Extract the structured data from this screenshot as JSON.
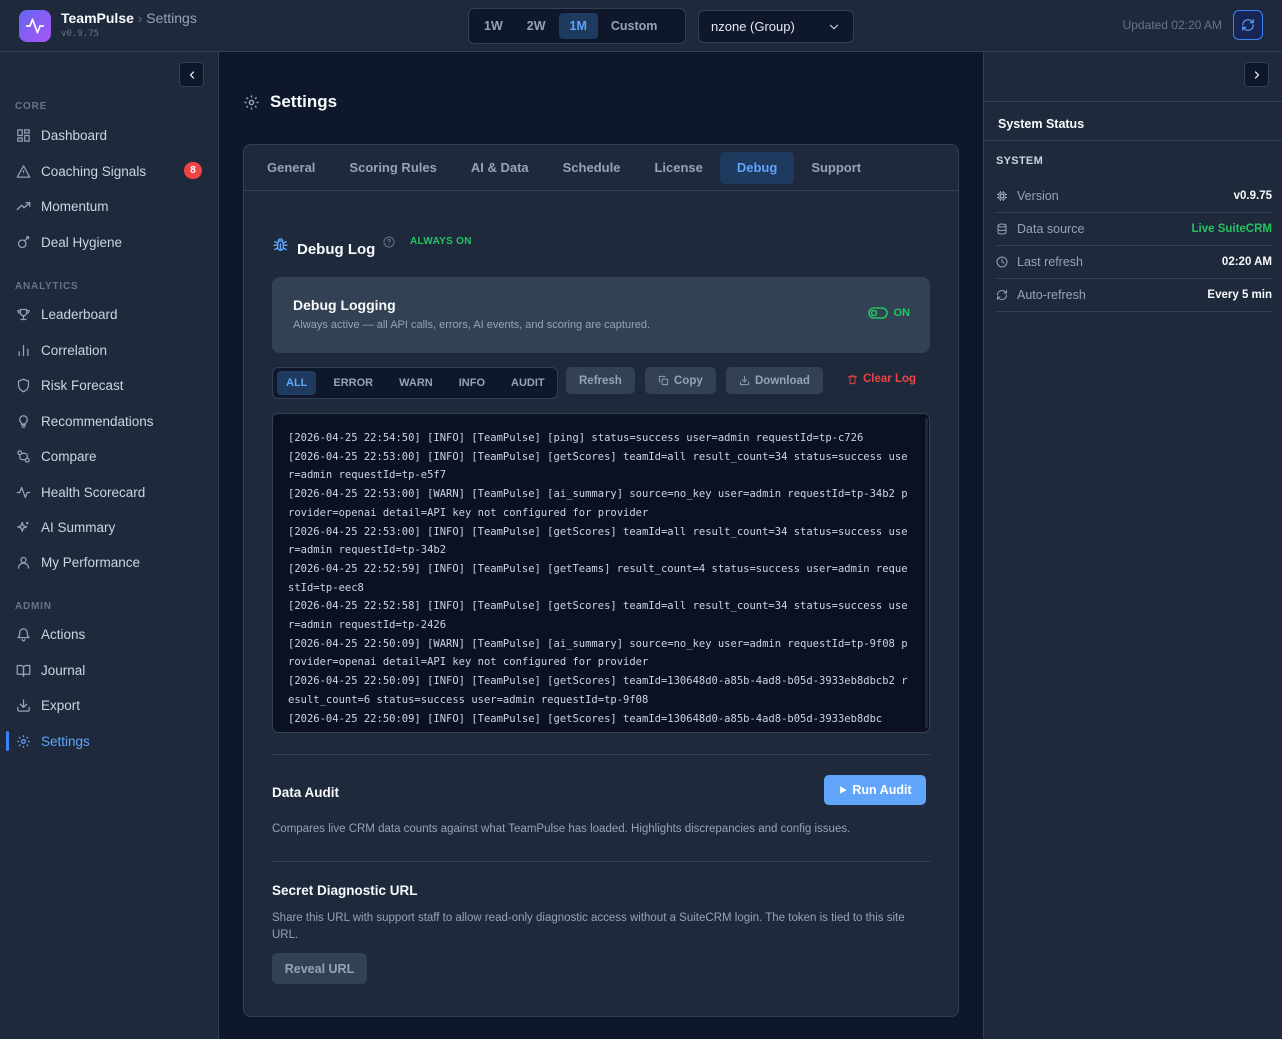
{
  "app": {
    "name": "TeamPulse",
    "page": "Settings",
    "version": "v0.9.75",
    "separator": "›"
  },
  "header": {
    "ranges": [
      "1W",
      "2W",
      "1M",
      "Custom"
    ],
    "active_range": "1M",
    "team_select": "nzone (Group)",
    "updated": "Updated 02:20 AM"
  },
  "sidebar": {
    "sections": [
      {
        "label": "CORE",
        "items": [
          {
            "label": "Dashboard",
            "icon": "dashboard-icon"
          },
          {
            "label": "Coaching Signals",
            "icon": "warning-icon",
            "badge": "8"
          },
          {
            "label": "Momentum",
            "icon": "trend-icon"
          },
          {
            "label": "Deal Hygiene",
            "icon": "hygiene-icon"
          }
        ]
      },
      {
        "label": "ANALYTICS",
        "items": [
          {
            "label": "Leaderboard",
            "icon": "trophy-icon"
          },
          {
            "label": "Correlation",
            "icon": "bar-chart-icon"
          },
          {
            "label": "Risk Forecast",
            "icon": "shield-icon"
          },
          {
            "label": "Recommendations",
            "icon": "lightbulb-icon"
          },
          {
            "label": "Compare",
            "icon": "compare-icon"
          },
          {
            "label": "Health Scorecard",
            "icon": "pulse-icon"
          },
          {
            "label": "AI Summary",
            "icon": "sparkles-icon"
          },
          {
            "label": "My Performance",
            "icon": "user-icon"
          }
        ]
      },
      {
        "label": "ADMIN",
        "items": [
          {
            "label": "Actions",
            "icon": "bell-icon"
          },
          {
            "label": "Journal",
            "icon": "book-icon"
          },
          {
            "label": "Export",
            "icon": "download-icon"
          },
          {
            "label": "Settings",
            "icon": "gear-icon",
            "active": true
          }
        ]
      }
    ]
  },
  "main": {
    "title": "Settings",
    "tabs": [
      "General",
      "Scoring Rules",
      "AI & Data",
      "Schedule",
      "License",
      "Debug",
      "Support"
    ],
    "active_tab": "Debug",
    "debug": {
      "title": "Debug Log",
      "always_on": "ALWAYS ON",
      "card_title": "Debug Logging",
      "card_sub": "Always active — all API calls, errors, AI events, and scoring are captured.",
      "toggle_label": "ON",
      "filters": [
        "ALL",
        "ERROR",
        "WARN",
        "INFO",
        "AUDIT"
      ],
      "active_filter": "ALL",
      "refresh": "Refresh",
      "copy": "Copy",
      "download": "Download",
      "clear": "Clear Log",
      "lines": [
        "[2026-04-25 22:54:50] [INFO] [TeamPulse] [ping] status=success user=admin requestId=tp-c726",
        "[2026-04-25 22:53:00] [INFO] [TeamPulse] [getScores] teamId=all result_count=34 status=success user=admin requestId=tp-e5f7",
        "[2026-04-25 22:53:00] [WARN] [TeamPulse] [ai_summary] source=no_key user=admin requestId=tp-34b2 provider=openai detail=API key not configured for provider",
        "[2026-04-25 22:53:00] [INFO] [TeamPulse] [getScores] teamId=all result_count=34 status=success user=admin requestId=tp-34b2",
        "[2026-04-25 22:52:59] [INFO] [TeamPulse] [getTeams] result_count=4 status=success user=admin requestId=tp-eec8",
        "[2026-04-25 22:52:58] [INFO] [TeamPulse] [getScores] teamId=all result_count=34 status=success user=admin requestId=tp-2426",
        "[2026-04-25 22:50:09] [WARN] [TeamPulse] [ai_summary] source=no_key user=admin requestId=tp-9f08 provider=openai detail=API key not configured for provider",
        "[2026-04-25 22:50:09] [INFO] [TeamPulse] [getScores] teamId=130648d0-a85b-4ad8-b05d-3933eb8dbcb2 result_count=6 status=success user=admin requestId=tp-9f08",
        "[2026-04-25 22:50:09] [INFO] [TeamPulse] [getScores] teamId=130648d0-a85b-4ad8-b05d-3933eb8dbc"
      ]
    },
    "audit": {
      "title": "Data Audit",
      "button": "Run Audit",
      "text": "Compares live CRM data counts against what TeamPulse has loaded. Highlights discrepancies and config issues."
    },
    "secret": {
      "title": "Secret Diagnostic URL",
      "text": "Share this URL with support staff to allow read-only diagnostic access without a SuiteCRM login. The token is tied to this site URL.",
      "button": "Reveal URL"
    }
  },
  "status_panel": {
    "title": "System Status",
    "section": "SYSTEM",
    "rows": [
      {
        "label": "Version",
        "value": "v0.9.75",
        "icon": "chip-icon"
      },
      {
        "label": "Data source",
        "value": "Live SuiteCRM",
        "icon": "database-icon",
        "color": "#22c55e"
      },
      {
        "label": "Last refresh",
        "value": "02:20 AM",
        "icon": "clock-icon"
      },
      {
        "label": "Auto-refresh",
        "value": "Every 5 min",
        "icon": "refresh-icon"
      }
    ]
  }
}
